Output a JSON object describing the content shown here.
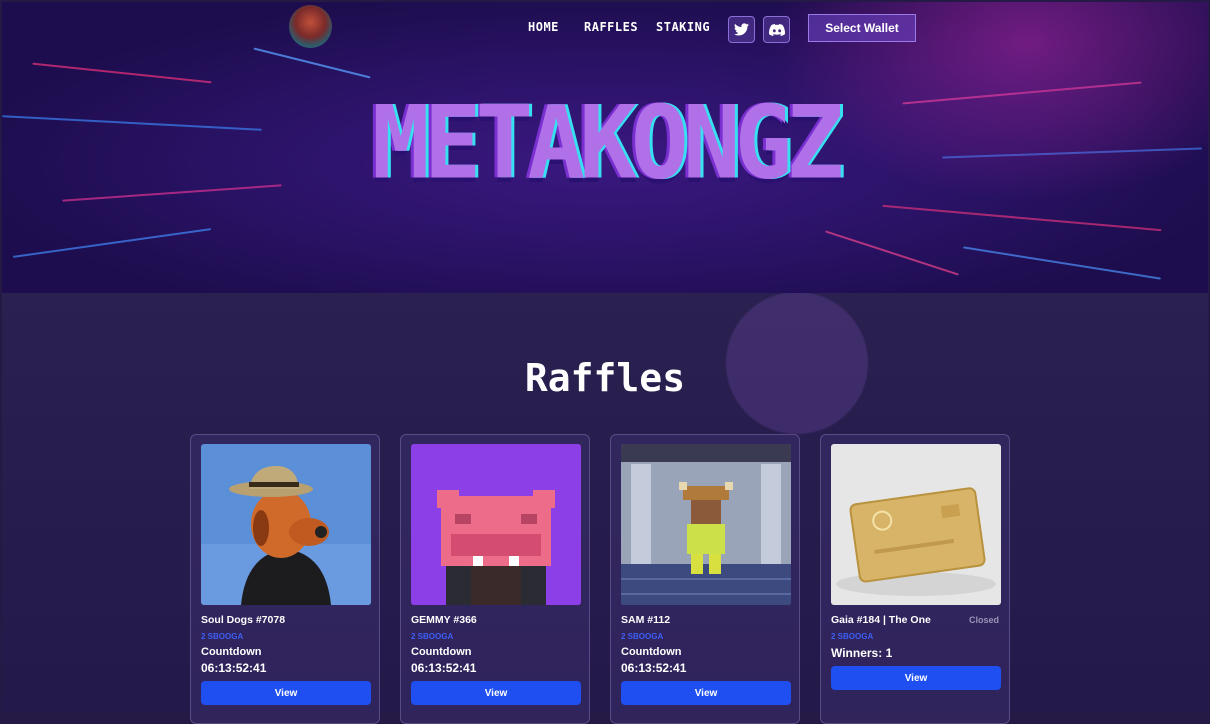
{
  "header": {
    "nav": [
      {
        "label": "HOME"
      },
      {
        "label": "RAFFLES"
      },
      {
        "label": "STAKING"
      }
    ],
    "social": [
      {
        "icon": "twitter-icon"
      },
      {
        "icon": "discord-icon"
      }
    ],
    "wallet_label": "Select Wallet"
  },
  "hero": {
    "brand": "METAKONGZ"
  },
  "raffles": {
    "title": "Raffles",
    "cards": [
      {
        "name": "Soul Dogs #7078",
        "price": "2 SBOOGA",
        "label": "Countdown",
        "time": "06:13:52:41",
        "button": "View"
      },
      {
        "name": "GEMMY #366",
        "price": "2 SBOOGA",
        "label": "Countdown",
        "time": "06:13:52:41",
        "button": "View"
      },
      {
        "name": "SAM #112",
        "price": "2 SBOOGA",
        "label": "Countdown",
        "time": "06:13:52:41",
        "button": "View"
      },
      {
        "name": "Gaia #184 | The One",
        "price": "2 SBOOGA",
        "status": "Closed",
        "winners": "Winners: 1",
        "button": "View"
      }
    ]
  },
  "colors": {
    "accent": "#1f4ff0",
    "price": "#3d5ef5",
    "hero_bg": "#2b1368",
    "section_bg": "#241a45"
  }
}
